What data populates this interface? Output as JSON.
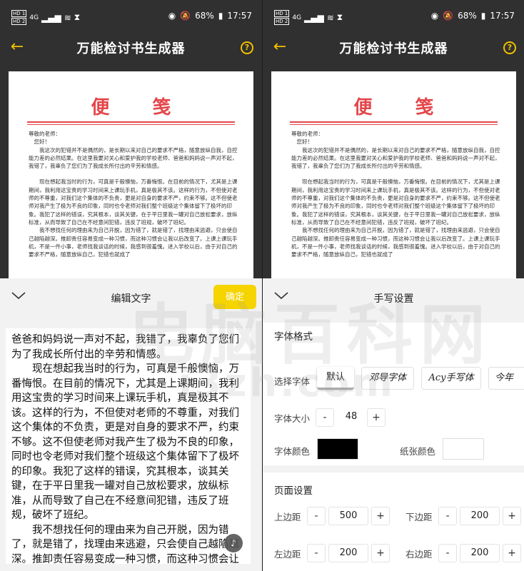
{
  "status_bar": {
    "sim1": "HD 1",
    "sim2": "HD 2",
    "signal": "4G",
    "battery": "68%",
    "time": "17:57"
  },
  "app_bar": {
    "title": "万能检讨书生成器"
  },
  "preview": {
    "heading": "便笺",
    "greeting": "尊敬的老师：",
    "salute": "您好！",
    "paragraphs": [
      "我这次的犯错并不是偶然的，是长期以来对自己的要求不严格，随意放纵自我，自控能力差的必然结果。在这里我要对关心和爱护我的学校老师、爸爸和妈妈说一声对不起，我错了，我辜负了您们为了我成长所付出的辛劳和情感。",
      "现在想起我当时的行为，可真是千般懊恼，万番悔恨。在目前的情况下，尤其是上课期间，我利用这宝贵的学习时间来上课玩手机，真是极其不该。这样的行为，不但使对老师的不尊重，对我们这个集体的不负责，更是对自身的要求不严，约束不够。这不但使老师对我产生了极为不良的印象，同时也令老师对我们整个班级这个集体留下了极坏的印象。我犯了这样的错误，究其根本，谈其关键，在于平日里我一罐对自己放松要求，放纵标准，从而导致了自己在不经意间犯错，违反了班规，破坏了班纪。",
      "我不想找任何的理由来为自己开脱，因为错了，就是错了，找理由来逃避，只会使自己越陷越深。推卸责任容易变成一种习惯，而这种习惯会让我以后改变了。上课上课玩手机，不是一件小事，老师找我谈话的时候，我感到很羞愧。进入学校以后，由于对自己的要求不严格，随意放纵自己，犯错也就成了"
    ]
  },
  "edit_sheet": {
    "title": "编辑文字",
    "confirm_label": "确定",
    "text_lines": [
      "爸爸和妈妈说一声对不起，我错了，我辜负了您们为了我成长所付出的辛劳和情感。",
      "现在想起我当时的行为，可真是千般懊恼，万番悔恨。在目前的情况下，尤其是上课期间，我利用这宝贵的学习时间来上课玩手机，真是极其不该。这样的行为，不但使对老师的不尊重，对我们这个集体的不负责，更是对自身的要求不严，约束不够。这不但使老师对我产生了极为不良的印象，同时也令老师对我们整个班级这个集体留下了极坏的印象。我犯了这样的错误，究其根本，谈其关键，在于平日里我一罐对自己放松要求，放纵标准，从而导致了自己在不经意间犯错，违反了班规，破坏了班纪。",
      "我不想找任何的理由来为自己开脱，因为错了，就是错了，找理由来逃避，只会使自己越陷越深。推卸责任容易变成一种习惯，而这种习惯会让我以后改变了。上课上课玩手机，不是一件"
    ],
    "fab_label": "♪"
  },
  "watermark": {
    "main": "电脑百科网",
    "sub": "i3zh.com"
  },
  "handwriting_sheet": {
    "title": "手写设置",
    "font_section": {
      "title": "字体格式",
      "choose_font_label": "选择字体",
      "font_options": [
        "默认",
        "邓导字体",
        "Acy手写体",
        "今年"
      ],
      "size_label": "字体大小",
      "size_minus": "-",
      "size_value": "48",
      "size_plus": "+",
      "font_color_label": "字体颜色",
      "font_color": "#000000",
      "paper_color_label": "纸张颜色",
      "paper_color": "#ffffff"
    },
    "page_section": {
      "title": "页面设置",
      "top_margin_label": "上边距",
      "top_margin_value": "500",
      "bottom_margin_label": "下边距",
      "bottom_margin_value": "200",
      "left_margin_label": "左边距",
      "left_margin_value": "200",
      "right_margin_label": "右边距",
      "right_margin_value": "200",
      "minus": "-",
      "plus": "+"
    }
  },
  "colors": {
    "accent": "#f2c100",
    "confirm_bg": "#f5d400",
    "heading_red": "#e4464a",
    "dark_bg": "#303030"
  }
}
